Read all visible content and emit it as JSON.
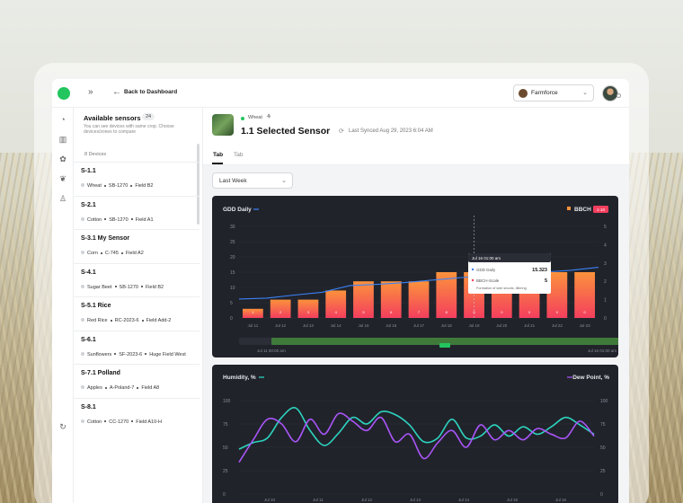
{
  "topbar": {
    "back_label": "Back to Dashboard",
    "farm_name": "Farmforce",
    "expand_icon": "double-chevron-right-icon",
    "back_icon": "arrow-left-icon"
  },
  "rail": {
    "icons": [
      "dashboard-icon",
      "map-icon",
      "sensors-icon",
      "leaf-icon",
      "user-icon",
      "refresh-icon"
    ]
  },
  "panel": {
    "title": "Available sensors",
    "count": "24",
    "subtitle": "You can see devices with same crop. Choose devices/zones to compare",
    "devices_label": "8 Devices",
    "sensors": [
      {
        "name": "S-1.1",
        "crop": "Wheat",
        "model": "SB-1270",
        "field": "Field B2"
      },
      {
        "name": "S-2.1",
        "crop": "Cotton",
        "model": "SB-1270",
        "field": "Field A1"
      },
      {
        "name": "S-3.1 My Sensor",
        "crop": "Corn",
        "model": "C-745",
        "field": "Field A2"
      },
      {
        "name": "S-4.1",
        "crop": "Sugar Beet",
        "model": "SB-1270",
        "field": "Field B2"
      },
      {
        "name": "S-5.1 Rice",
        "crop": "Red Rice",
        "model": "RC-2023-6",
        "field": "Field Add-2"
      },
      {
        "name": "S-6.1",
        "crop": "Sunflowers",
        "model": "SF-2023-6",
        "field": "Huge Field West"
      },
      {
        "name": "S-7.1 Polland",
        "crop": "Apples",
        "model": "A-Poland-7",
        "field": "Field A8"
      },
      {
        "name": "S-8.1",
        "crop": "Cotton",
        "model": "CC-1270",
        "field": "Field A10-H"
      }
    ]
  },
  "main": {
    "crop": "Wheat",
    "title": "1.1 Selected Sensor",
    "synced": "Last Synced Aug 29, 2023 6:04 AM",
    "tabs": [
      "Tab",
      "Tab"
    ],
    "range": "Last Week"
  },
  "colors": {
    "accent": "#22c55e",
    "bar_top": "#fb923c",
    "bar_bottom": "#f43f5e",
    "gdd_line": "#3b82f6",
    "humidity": "#2dd4bf",
    "dew": "#a855f7",
    "card_bg": "#21232b"
  },
  "chart_data": [
    {
      "type": "bar",
      "title": "GDD Daily",
      "legend_right": "BBCH",
      "badge": "1-10",
      "categories": [
        "Jul 11",
        "Jul 12",
        "Jul 13",
        "Jul 14",
        "Jul 15",
        "Jul 16",
        "Jul 17",
        "Jul 18",
        "Jul 19",
        "Jul 20",
        "Jul 21",
        "Jul 22",
        "Jul 23"
      ],
      "bar_values": [
        3,
        6,
        6,
        9,
        12,
        12,
        12,
        15,
        15,
        15,
        15,
        15,
        15
      ],
      "bar_labels": [
        "1",
        "2",
        "3",
        "4",
        "5",
        "6",
        "7",
        "8",
        "9",
        "0",
        "0",
        "0",
        "0"
      ],
      "line_values": [
        6.2,
        6.5,
        7.5,
        8.4,
        10.6,
        11.0,
        11.6,
        12.4,
        13.2,
        13.9,
        14.2,
        15.0,
        15.6,
        16.6
      ],
      "ylim_left": [
        0,
        30
      ],
      "yticks_left": [
        "0",
        "5",
        "10",
        "15",
        "20",
        "25",
        "30"
      ],
      "yticks_right": [
        "0",
        "1",
        "2",
        "3",
        "4",
        "5"
      ],
      "range_start": "Jul 11 00:00 am",
      "range_end": "Jul 16 01:00 am",
      "tooltip": {
        "date": "Jul 16 01:00 am",
        "gdd_label": "GDD Daily",
        "gdd_value": "15.323",
        "bbch_label": "BBCH-Scale",
        "bbch_value": "5",
        "note": "Formation of side shoots, tillering"
      }
    },
    {
      "type": "line",
      "title": "Humidity, %",
      "legend_right": "Dew Point, %",
      "categories": [
        "Jul 10",
        "Jul 11",
        "Jul 12",
        "Jul 13",
        "Jul 14",
        "Jul 15",
        "Jul 16"
      ],
      "yticks_left": [
        "0",
        "25",
        "50",
        "75",
        "100"
      ],
      "yticks_right": [
        "0",
        "25",
        "50",
        "75",
        "100"
      ],
      "ylim": [
        0,
        100
      ],
      "series": [
        {
          "name": "Humidity, %",
          "values": [
            48,
            55,
            60,
            82,
            92,
            68,
            52,
            65,
            82,
            75,
            88,
            85,
            74,
            56,
            60,
            80,
            60,
            62,
            74,
            62,
            72,
            64,
            72,
            82,
            74,
            64
          ]
        },
        {
          "name": "Dew Point, %",
          "values": [
            34,
            58,
            80,
            75,
            56,
            80,
            64,
            86,
            78,
            68,
            82,
            56,
            64,
            38,
            55,
            68,
            50,
            74,
            58,
            68,
            58,
            70,
            64,
            60,
            78,
            62
          ]
        }
      ]
    }
  ]
}
